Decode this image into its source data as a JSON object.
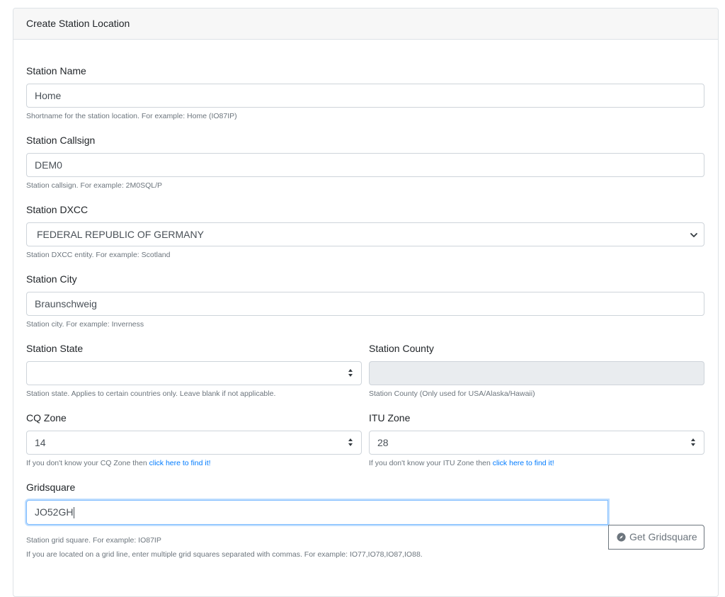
{
  "card": {
    "title": "Create Station Location"
  },
  "fields": {
    "name": {
      "label": "Station Name",
      "value": "Home",
      "help": "Shortname for the station location. For example: Home (IO87IP)"
    },
    "callsign": {
      "label": "Station Callsign",
      "value": "DEM0",
      "help": "Station callsign. For example: 2M0SQL/P"
    },
    "dxcc": {
      "label": "Station DXCC",
      "value": "FEDERAL REPUBLIC OF GERMANY",
      "help": "Station DXCC entity. For example: Scotland"
    },
    "city": {
      "label": "Station City",
      "value": "Braunschweig",
      "help": "Station city. For example: Inverness"
    },
    "state": {
      "label": "Station State",
      "value": "",
      "help": "Station state. Applies to certain countries only. Leave blank if not applicable."
    },
    "county": {
      "label": "Station County",
      "value": "",
      "help": "Station County (Only used for USA/Alaska/Hawaii)"
    },
    "cq": {
      "label": "CQ Zone",
      "value": "14",
      "help_prefix": "If you don't know your CQ Zone then ",
      "help_link": "click here to find it!"
    },
    "itu": {
      "label": "ITU Zone",
      "value": "28",
      "help_prefix": "If you don't know your ITU Zone then ",
      "help_link": "click here to find it!"
    },
    "grid": {
      "label": "Gridsquare",
      "value": "JO52GH",
      "button": "Get Gridsquare",
      "button_icon": "compass-icon",
      "help1": "Station grid square. For example: IO87IP",
      "help2": "If you are located on a grid line, enter multiple grid squares separated with commas. For example: IO77,IO78,IO87,IO88."
    }
  },
  "colors": {
    "link": "#007bff",
    "focus_border": "#80bdff",
    "disabled_bg": "#e9ecef",
    "header_bg": "#f7f7f7"
  }
}
